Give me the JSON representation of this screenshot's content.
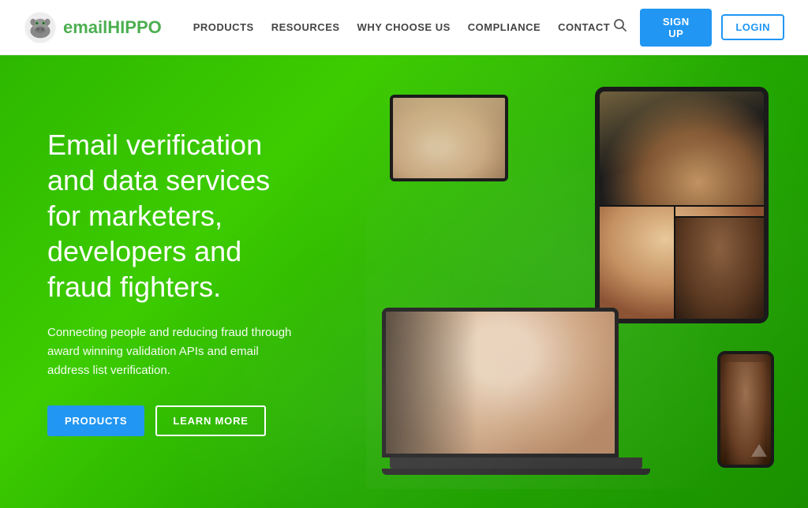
{
  "header": {
    "logo_text_prefix": "email",
    "logo_text_suffix": "HIPPO",
    "nav": {
      "products": "PRODUCTS",
      "resources": "RESOURCES",
      "why_choose_us": "WHY CHOOSE US",
      "compliance": "COMPLIANCE",
      "contact": "CONTACT"
    },
    "signup_label": "SIGN UP",
    "login_label": "LOGIN"
  },
  "hero": {
    "headline": "Email verification and data services for marketers, developers and fraud fighters.",
    "subtext": "Connecting people and reducing fraud through award winning validation APIs and email address list verification.",
    "btn_products": "PRODUCTS",
    "btn_learn": "LEARN MORE"
  },
  "colors": {
    "green": "#2db800",
    "blue": "#2196f3",
    "white": "#ffffff"
  }
}
